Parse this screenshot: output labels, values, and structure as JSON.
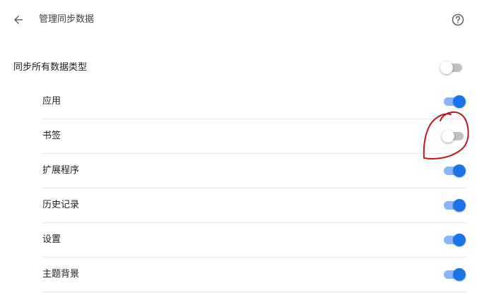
{
  "header": {
    "title": "管理同步数据",
    "back_icon": "arrow-back-icon",
    "help_icon": "help-circle-icon"
  },
  "sync_all": {
    "label": "同步所有数据类型",
    "enabled": false
  },
  "items": [
    {
      "label": "应用",
      "enabled": true
    },
    {
      "label": "书签",
      "enabled": false
    },
    {
      "label": "扩展程序",
      "enabled": true
    },
    {
      "label": "历史记录",
      "enabled": true
    },
    {
      "label": "设置",
      "enabled": true
    },
    {
      "label": "主题背景",
      "enabled": true
    }
  ],
  "colors": {
    "toggle_on_knob": "#1a73e8",
    "toggle_on_track": "#8ab4f8",
    "toggle_off_track": "#bdc1c6",
    "annotation": "#c0181b"
  }
}
